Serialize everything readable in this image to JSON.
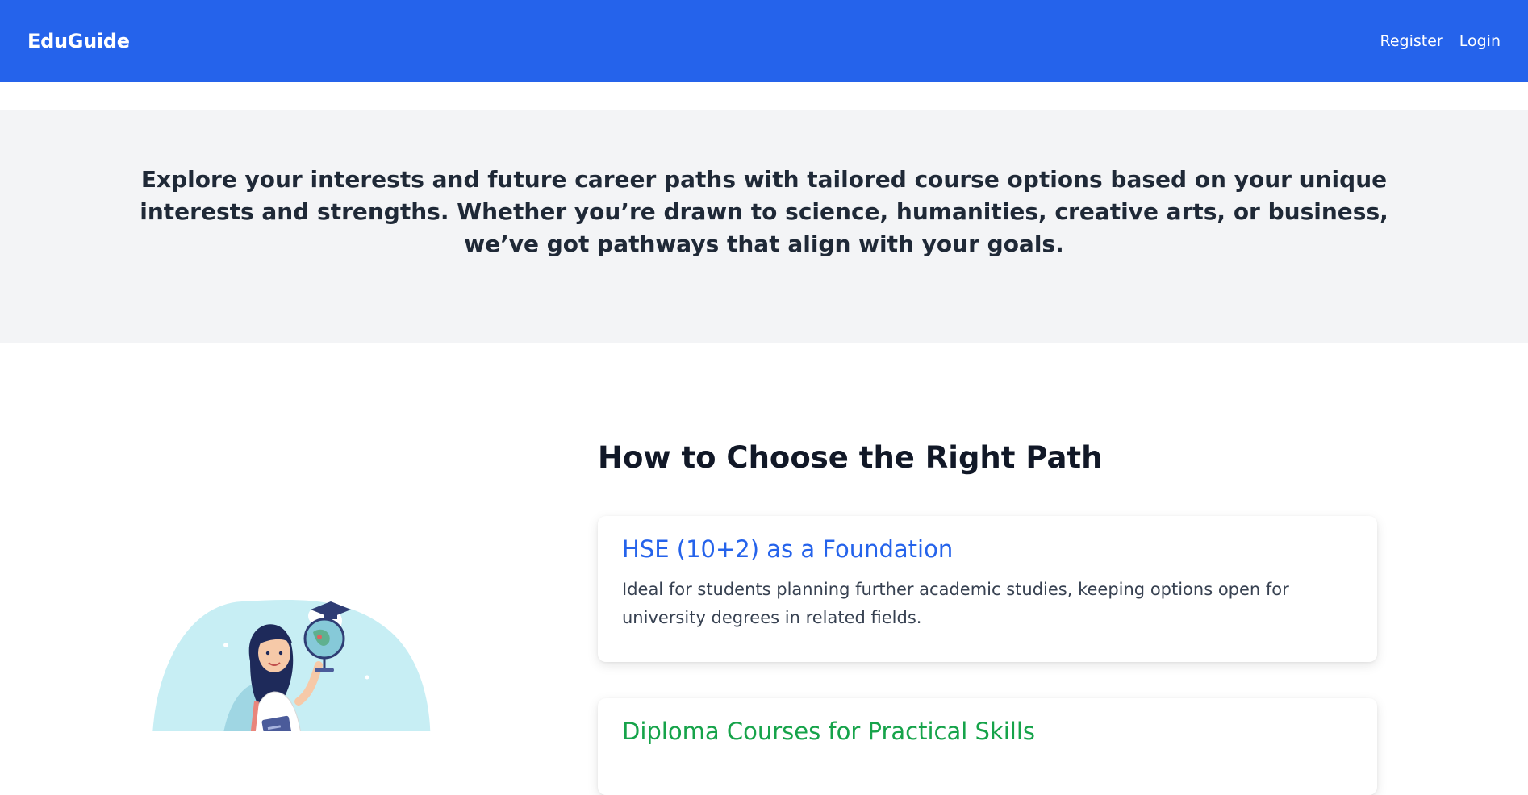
{
  "navbar": {
    "brand": "EduGuide",
    "links": [
      {
        "label": "Register"
      },
      {
        "label": "Login"
      }
    ],
    "color": "#2563eb"
  },
  "hero": {
    "text": "Explore your interests and future career paths with tailored course options based on your unique interests and strengths. Whether you’re drawn to science, humanities, creative arts, or business, we’ve got pathways that align with your goals."
  },
  "main": {
    "title": "How to Choose the Right Path",
    "illustration": "student-with-globe-illustration",
    "cards": [
      {
        "title": "HSE (10+2) as a Foundation",
        "description": "Ideal for students planning further academic studies, keeping options open for university degrees in related fields.",
        "accent": "#2563eb"
      },
      {
        "title": "Diploma Courses for Practical Skills",
        "accent": "#16a34a"
      }
    ]
  }
}
